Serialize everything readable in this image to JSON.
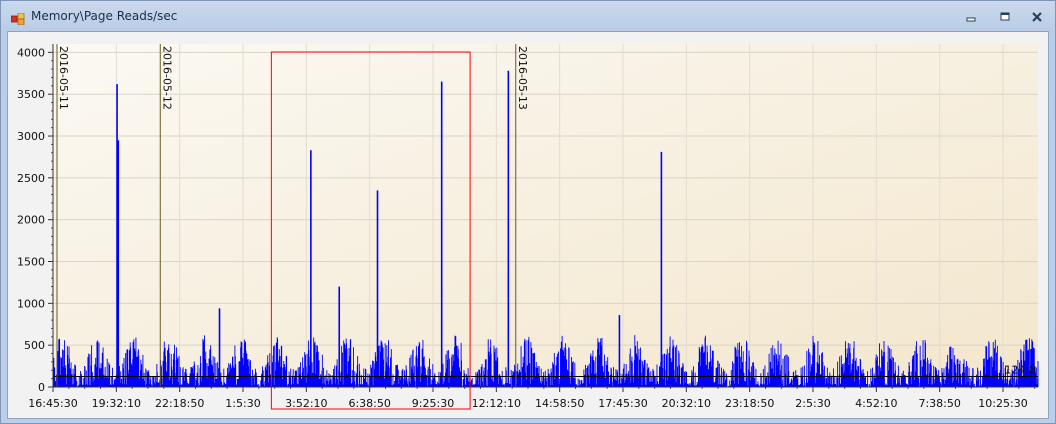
{
  "window": {
    "title": "Memory\\Page Reads/sec",
    "icon": "chart-app-icon",
    "buttons": [
      "minimize-icon",
      "restore-icon",
      "close-icon"
    ]
  },
  "colors": {
    "series": "#0000ff",
    "threshold": "#000000",
    "selection": "#ff0000",
    "day_marker": "#6b5a1e",
    "plot_bg_light": "#fbf9f3",
    "plot_bg_dark": "#f3e6cc"
  },
  "chart_data": {
    "type": "line",
    "title": "Memory\\Page Reads/sec",
    "xlabel": "",
    "ylabel": "",
    "ylim": [
      0,
      4100
    ],
    "grid": true,
    "y_ticks": [
      0,
      500,
      1000,
      1500,
      2000,
      2500,
      3000,
      3500,
      4000
    ],
    "x_range_hours": [
      0,
      66.5
    ],
    "x_tick_labels": [
      "16:45:30",
      "19:32:10",
      "22:18:50",
      "1:5:30",
      "3:52:10",
      "6:38:50",
      "9:25:30",
      "12:12:10",
      "14:58:50",
      "17:45:30",
      "20:32:10",
      "23:18:50",
      "2:5:30",
      "4:52:10",
      "7:38:50",
      "10:25:30"
    ],
    "day_markers": [
      {
        "label": "2016-05-11",
        "at": "16:45:30"
      },
      {
        "label": "2016-05-12",
        "at": "00:00:00"
      },
      {
        "label": "2016-05-13",
        "at": "00:00:00"
      }
    ],
    "threshold_value": 124.8,
    "threshold_label": "124.8",
    "selection_range": [
      "7:30",
      "20:55"
    ],
    "peaks": [
      {
        "time": "21:05",
        "value": 3620
      },
      {
        "time": "21:10",
        "value": 2950
      },
      {
        "time": "12:05",
        "value": 1200
      },
      {
        "time": "4:00",
        "value": 940
      },
      {
        "time": "10:10",
        "value": 2830
      },
      {
        "time": "14:40",
        "value": 2350
      },
      {
        "time": "19:00",
        "value": 3650
      },
      {
        "time": "23:30",
        "value": 3780
      },
      {
        "time": "7:00",
        "value": 860
      },
      {
        "time": "9:50",
        "value": 2810
      }
    ],
    "series": [
      {
        "name": "Memory\\Page Reads/sec",
        "baseline_range": [
          0,
          620
        ],
        "samples": 2400
      }
    ]
  }
}
